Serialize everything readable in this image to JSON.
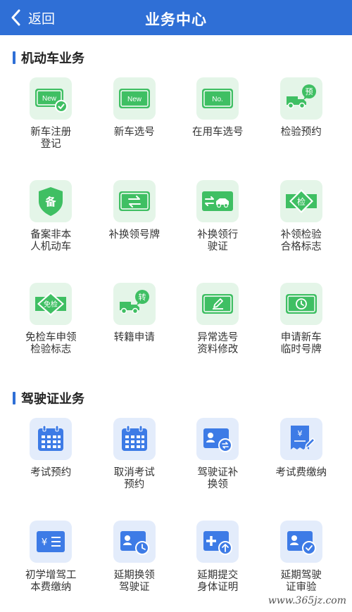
{
  "header": {
    "back_label": "返回",
    "title": "业务中心"
  },
  "sections": [
    {
      "title": "机动车业务",
      "items": [
        {
          "label": "新车注册\n登记",
          "icon": "new-plate-check-icon",
          "badge": "New"
        },
        {
          "label": "新车选号",
          "icon": "new-plate-icon",
          "badge": "New"
        },
        {
          "label": "在用车选号",
          "icon": "no-plate-icon",
          "badge": "No."
        },
        {
          "label": "检验预约",
          "icon": "truck-appointment-icon",
          "badge": "预"
        },
        {
          "label": "备案非本\n人机动车",
          "icon": "shield-record-icon",
          "badge": "备"
        },
        {
          "label": "补换领号牌",
          "icon": "plate-exchange-icon"
        },
        {
          "label": "补换领行\n驶证",
          "icon": "license-exchange-car-icon"
        },
        {
          "label": "补领检验\n合格标志",
          "icon": "inspection-sign-icon",
          "badge": "检"
        },
        {
          "label": "免检车申领\n检验标志",
          "icon": "exempt-sign-icon",
          "badge": "免检"
        },
        {
          "label": "转籍申请",
          "icon": "truck-transfer-icon",
          "badge": "转"
        },
        {
          "label": "异常选号\n资料修改",
          "icon": "plate-edit-icon"
        },
        {
          "label": "申请新车\n临时号牌",
          "icon": "temporary-plate-icon"
        }
      ]
    },
    {
      "title": "驾驶证业务",
      "items": [
        {
          "label": "考试预约",
          "icon": "calendar-icon"
        },
        {
          "label": "取消考试\n预约",
          "icon": "calendar-cancel-icon"
        },
        {
          "label": "驾驶证补\n换领",
          "icon": "license-card-exchange-icon"
        },
        {
          "label": "考试费缴纳",
          "icon": "receipt-payment-icon",
          "badge": "¥"
        },
        {
          "label": "初学增驾工\n本费缴纳",
          "icon": "fee-list-icon",
          "badge": "¥"
        },
        {
          "label": "延期换领\n驾驶证",
          "icon": "license-clock-icon"
        },
        {
          "label": "延期提交\n身体证明",
          "icon": "medical-upload-icon"
        },
        {
          "label": "延期驾驶\n证审验",
          "icon": "license-check-icon"
        }
      ]
    }
  ],
  "watermark": "www.365jz.com",
  "colors": {
    "header": "#2f6fd6",
    "green": "#3fbf63",
    "blue": "#3d7be6"
  }
}
